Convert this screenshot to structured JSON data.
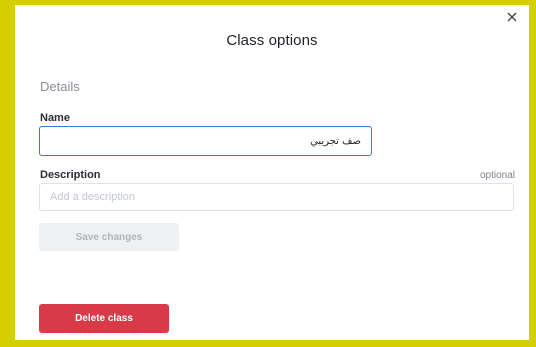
{
  "dialog": {
    "title": "Class options",
    "section_heading": "Details",
    "close_icon": "close-icon"
  },
  "name_field": {
    "label": "Name",
    "value": "صف تجريبي"
  },
  "description_field": {
    "label": "Description",
    "optional_label": "optional",
    "value": "",
    "placeholder": "Add a description"
  },
  "buttons": {
    "save_label": "Save changes",
    "delete_label": "Delete class"
  },
  "colors": {
    "frame": "#d4cf00",
    "focus_border": "#3a7ac8",
    "delete": "#d83a47",
    "disabled_bg": "#eff0f2"
  }
}
